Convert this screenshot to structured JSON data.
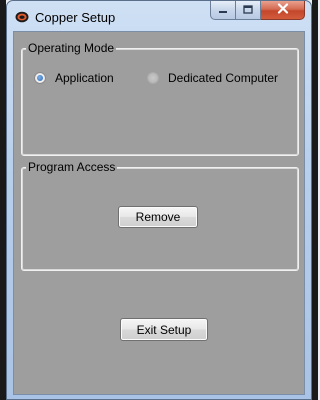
{
  "window": {
    "title": "Copper Setup",
    "controls": {
      "minimize": "minimize-icon",
      "maximize": "maximize-icon",
      "close": "close-icon"
    }
  },
  "operating_mode": {
    "legend": "Operating Mode",
    "options": [
      {
        "label": "Application",
        "selected": true
      },
      {
        "label": "Dedicated Computer",
        "selected": false
      }
    ]
  },
  "program_access": {
    "legend": "Program Access",
    "remove_label": "Remove"
  },
  "footer": {
    "exit_label": "Exit Setup"
  },
  "colors": {
    "client_background": "#9e9e9e",
    "titlebar": "#b9d0ec",
    "close_button": "#c4472c",
    "selected_radio": "#2a67b8"
  }
}
